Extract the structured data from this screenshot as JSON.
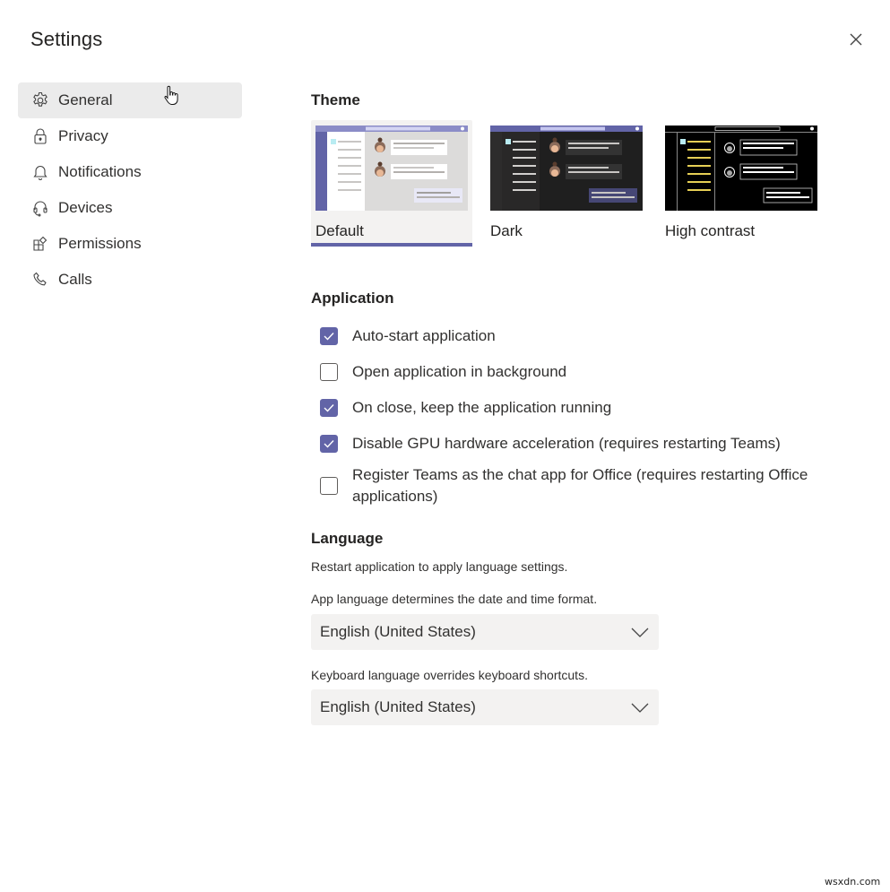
{
  "window": {
    "title": "Settings",
    "close_icon": "close-icon"
  },
  "sidebar": {
    "items": [
      {
        "label": "General",
        "icon": "gear-icon",
        "active": true
      },
      {
        "label": "Privacy",
        "icon": "lock-icon",
        "active": false
      },
      {
        "label": "Notifications",
        "icon": "bell-icon",
        "active": false
      },
      {
        "label": "Devices",
        "icon": "headset-icon",
        "active": false
      },
      {
        "label": "Permissions",
        "icon": "apps-icon",
        "active": false
      },
      {
        "label": "Calls",
        "icon": "phone-icon",
        "active": false
      }
    ]
  },
  "theme": {
    "title": "Theme",
    "options": [
      {
        "label": "Default",
        "selected": true
      },
      {
        "label": "Dark",
        "selected": false
      },
      {
        "label": "High contrast",
        "selected": false
      }
    ]
  },
  "application": {
    "title": "Application",
    "options": [
      {
        "label": "Auto-start application",
        "checked": true
      },
      {
        "label": "Open application in background",
        "checked": false
      },
      {
        "label": "On close, keep the application running",
        "checked": true
      },
      {
        "label": "Disable GPU hardware acceleration (requires restarting Teams)",
        "checked": true
      },
      {
        "label": "Register Teams as the chat app for Office (requires restarting Office applications)",
        "checked": false
      }
    ]
  },
  "language": {
    "title": "Language",
    "restart_note": "Restart application to apply language settings.",
    "app_language_note": "App language determines the date and time format.",
    "app_language_value": "English (United States)",
    "keyboard_language_note": "Keyboard language overrides keyboard shortcuts.",
    "keyboard_language_value": "English (United States)"
  },
  "colors": {
    "accent": "#6264a7",
    "selected_bg": "#ebebeb",
    "dropdown_bg": "#f3f2f1"
  },
  "watermark": "wsxdn.com"
}
